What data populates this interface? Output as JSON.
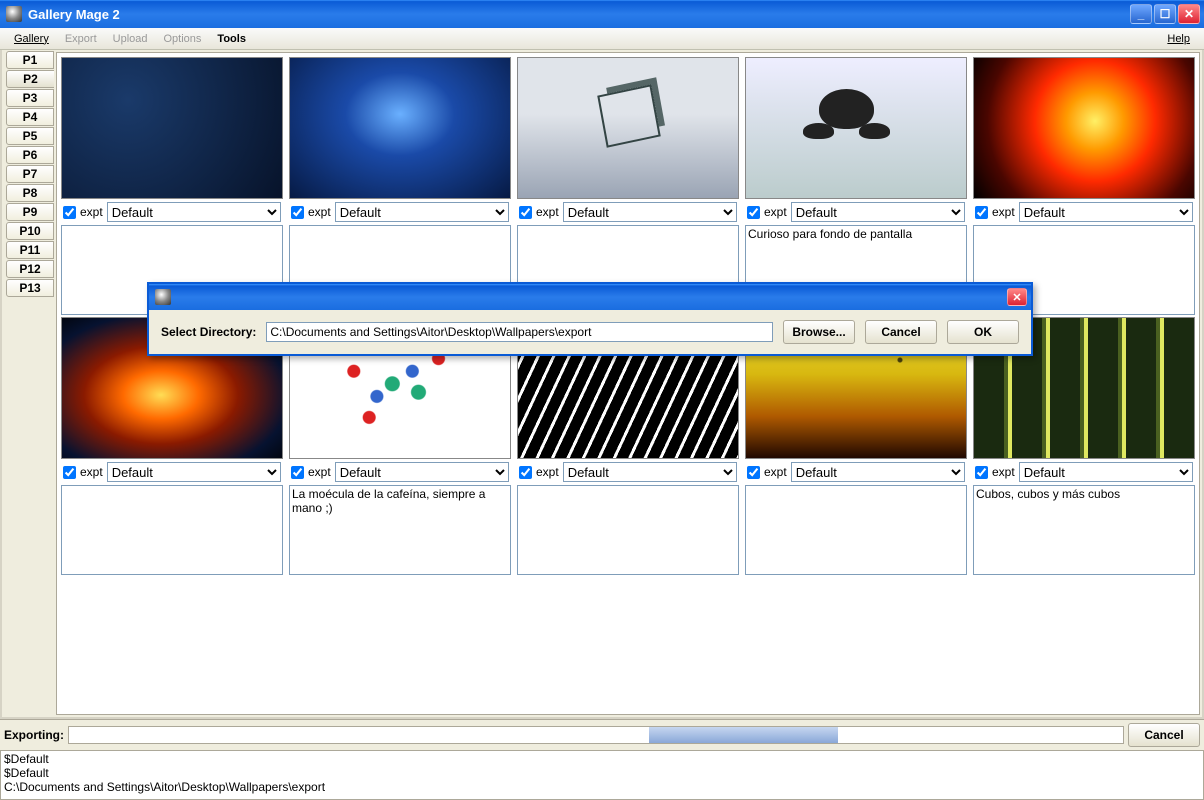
{
  "window": {
    "title": "Gallery Mage 2"
  },
  "menu": {
    "gallery": "Gallery",
    "export": "Export",
    "upload": "Upload",
    "options": "Options",
    "tools": "Tools",
    "help": "Help"
  },
  "pages": [
    "P1",
    "P2",
    "P3",
    "P4",
    "P5",
    "P6",
    "P7",
    "P8",
    "P9",
    "P10",
    "P11",
    "P12",
    "P13"
  ],
  "selected_page": "P2",
  "row_label": {
    "expt": "expt",
    "default_option": "Default"
  },
  "row1": [
    {
      "caption": ""
    },
    {
      "caption": ""
    },
    {
      "caption": ""
    },
    {
      "caption": "Curioso para fondo de pantalla"
    },
    {
      "caption": ""
    }
  ],
  "row2": [
    {
      "caption": ""
    },
    {
      "caption": "La moécula de la cafeína, siempre a mano ;)"
    },
    {
      "caption": ""
    },
    {
      "caption": ""
    },
    {
      "caption": "Cubos, cubos y más cubos"
    }
  ],
  "dialog": {
    "label": "Select Directory:",
    "path": "C:\\Documents and Settings\\Aitor\\Desktop\\Wallpapers\\export",
    "browse": "Browse...",
    "cancel": "Cancel",
    "ok": "OK"
  },
  "status": {
    "exporting_label": "Exporting:",
    "cancel": "Cancel",
    "log": [
      "$Default",
      "$Default",
      "C:\\Documents and Settings\\Aitor\\Desktop\\Wallpapers\\export"
    ]
  }
}
